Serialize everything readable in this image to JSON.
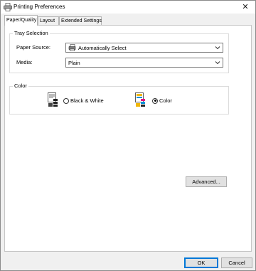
{
  "window": {
    "title": "Printing Preferences",
    "close_glyph": "✕"
  },
  "tabs": [
    {
      "label": "Paper/Quality",
      "active": true
    },
    {
      "label": "Layout",
      "active": false
    },
    {
      "label": "Extended Settings",
      "active": false
    }
  ],
  "tray": {
    "group_title": "Tray Selection",
    "paper_source_label": "Paper Source:",
    "paper_source_value": "Automatically Select",
    "media_label": "Media:",
    "media_value": "Plain"
  },
  "color": {
    "group_title": "Color",
    "bw_label": "Black & White",
    "color_label": "Color",
    "selected": "Color"
  },
  "buttons": {
    "advanced": "Advanced...",
    "ok": "OK",
    "cancel": "Cancel"
  },
  "icons": {
    "title": "printer-icon",
    "paper_source": "printer-tray-icon",
    "bw": "black-white-document-icon",
    "color": "color-document-icon"
  }
}
